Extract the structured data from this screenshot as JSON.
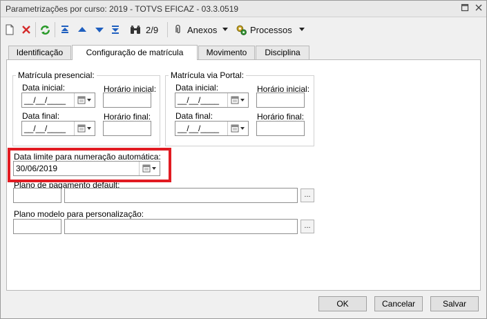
{
  "window": {
    "title": "Parametrizações por curso: 2019 - TOTVS EFICAZ - 03.3.0519"
  },
  "toolbar": {
    "record_counter": "2/9",
    "anexos_label": "Anexos",
    "processos_label": "Processos"
  },
  "tabs": [
    {
      "label": "Identificação",
      "active": false
    },
    {
      "label": "Configuração de matrícula",
      "active": true
    },
    {
      "label": "Movimento",
      "active": false
    },
    {
      "label": "Disciplina",
      "active": false
    }
  ],
  "presencial": {
    "title": "Matrícula presencial:",
    "data_inicial_label": "Data inicial:",
    "data_inicial_value": "__/__/____",
    "horario_inicial_label": "Horário inicial:",
    "horario_inicial_value": "",
    "data_final_label": "Data final:",
    "data_final_value": "__/__/____",
    "horario_final_label": "Horário final:",
    "horario_final_value": ""
  },
  "portal": {
    "title": "Matrícula via Portal:",
    "data_inicial_label": "Data inicial:",
    "data_inicial_value": "__/__/____",
    "horario_inicial_label": "Horário inicial:",
    "horario_inicial_value": "",
    "data_final_label": "Data final:",
    "data_final_value": "__/__/____",
    "horario_final_label": "Horário final:",
    "horario_final_value": ""
  },
  "data_limite": {
    "label": "Data limite para numeração automática:",
    "value": "30/06/2019"
  },
  "plano_pagamento": {
    "label": "Plano de pagamento default:",
    "code": "",
    "description": "",
    "browse_label": "..."
  },
  "plano_modelo": {
    "label": "Plano modelo para personalização:",
    "code": "",
    "description": "",
    "browse_label": "..."
  },
  "footer": {
    "ok_label": "OK",
    "cancel_label": "Cancelar",
    "save_label": "Salvar"
  },
  "colors": {
    "highlight": "#e11b22",
    "accent_blue": "#1f5fbf",
    "refresh_green": "#2a9a2a",
    "delete_red": "#d42a2a"
  }
}
